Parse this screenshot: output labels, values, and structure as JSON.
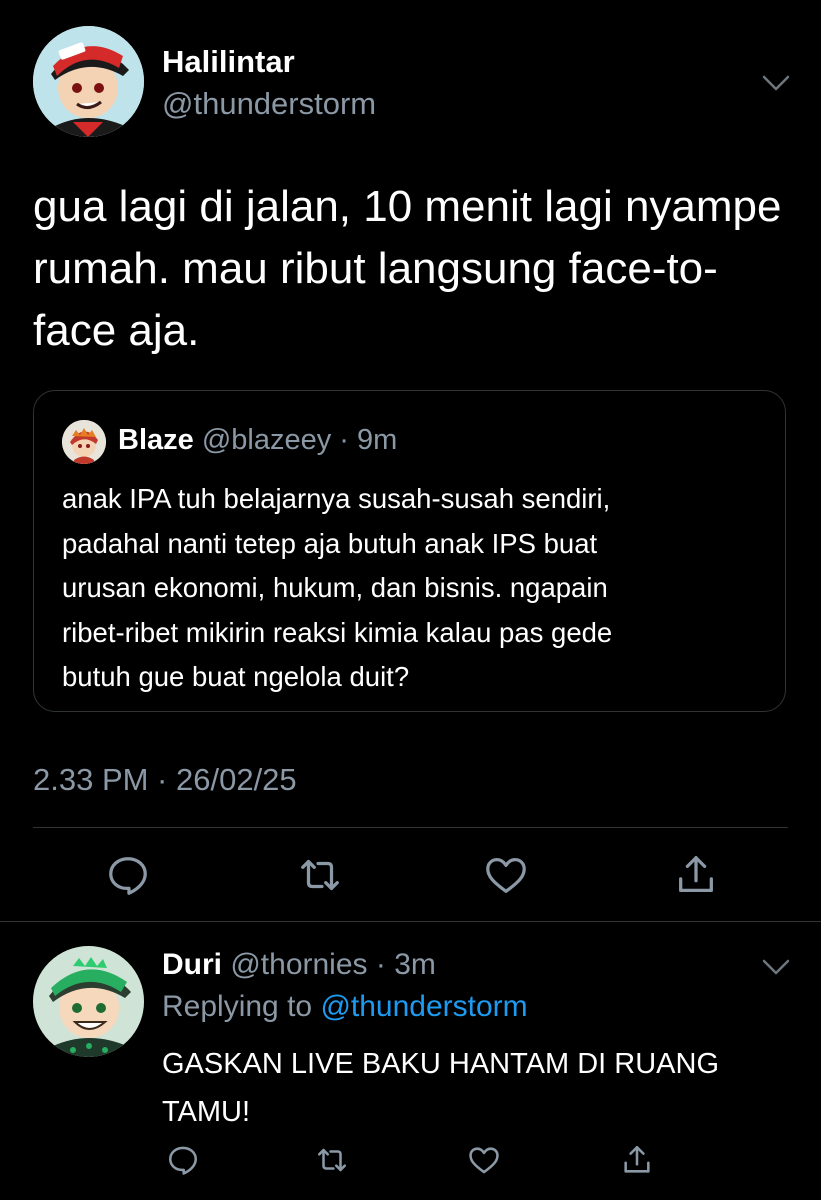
{
  "tweet": {
    "author_name": "Halilintar",
    "author_handle": "@thunderstorm",
    "text": "gua lagi di jalan, 10 menit lagi nyampe\nrumah. mau ribut langsung face-to-\nface aja.",
    "timestamp": "2.33 PM · 26/02/25",
    "menu_icon": "chevron-down-icon",
    "avatar_icon": "cartoon-avatar-red-cap",
    "actions": {
      "reply_icon": "reply-icon",
      "retweet_icon": "retweet-icon",
      "like_icon": "heart-icon",
      "share_icon": "share-icon"
    }
  },
  "quote": {
    "author_name": "Blaze",
    "author_handle": "@blazeey",
    "separator": " · ",
    "time": "9m",
    "avatar_icon": "cartoon-avatar-blaze",
    "text": "anak IPA tuh belajarnya susah-susah sendiri,\npadahal nanti tetep aja butuh anak IPS buat\nurusan ekonomi, hukum, dan bisnis. ngapain\nribet-ribet mikirin reaksi kimia kalau pas gede\nbutuh gue buat ngelola duit?"
  },
  "reply": {
    "author_name": "Duri",
    "author_handle": "@thornies",
    "separator": " · ",
    "time": "3m",
    "replying_prefix": "Replying to ",
    "replying_to": "@thunderstorm",
    "text": "GASKAN LIVE BAKU HANTAM DI RUANG\nTAMU!",
    "avatar_icon": "cartoon-avatar-green-cap",
    "menu_icon": "chevron-down-icon"
  },
  "colors": {
    "background": "#000000",
    "primary_text": "#ffffff",
    "secondary_text": "#8b98a5",
    "link": "#1d9bf0",
    "border": "#2f3336"
  }
}
